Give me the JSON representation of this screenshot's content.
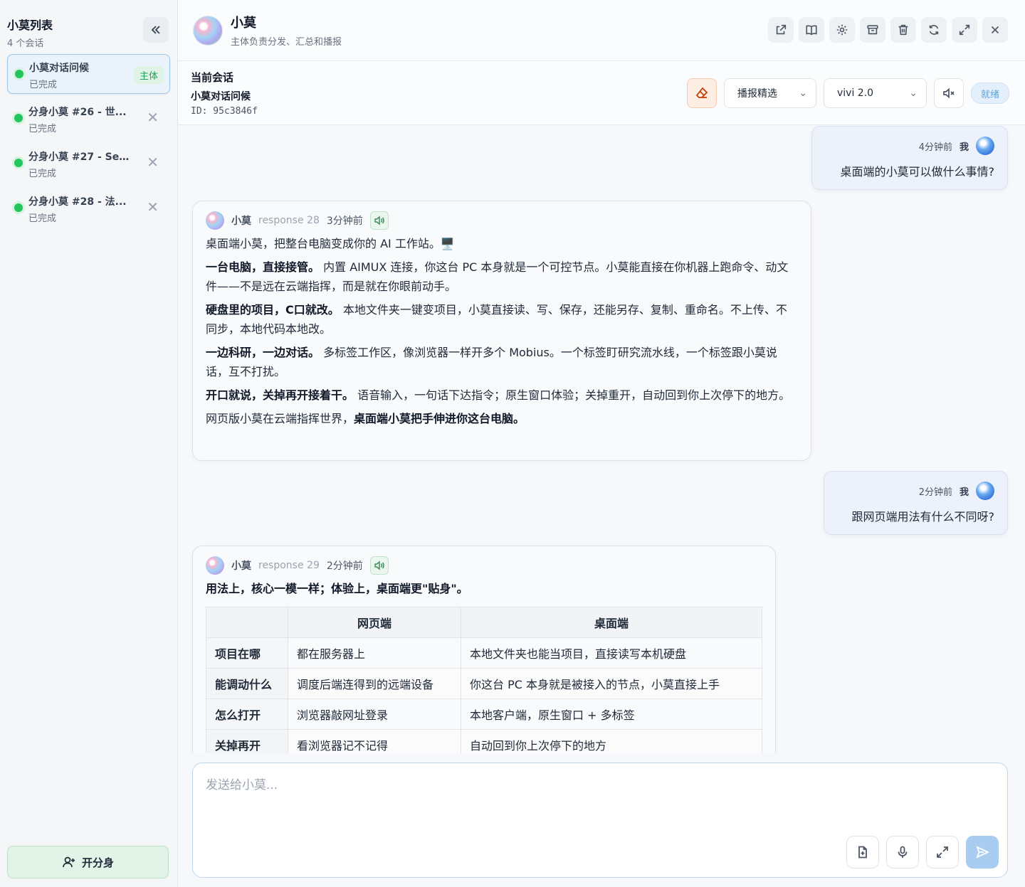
{
  "sidebar": {
    "title": "小莫列表",
    "count": "4 个会话",
    "items": [
      {
        "name": "小莫对话问候",
        "status": "已完成",
        "tag": "主体"
      },
      {
        "name": "分身小莫 #26 - 世...",
        "status": "已完成"
      },
      {
        "name": "分身小莫 #27 - Sel...",
        "status": "已完成"
      },
      {
        "name": "分身小莫 #28 - 法...",
        "status": "已完成"
      }
    ],
    "new_button": "开分身"
  },
  "topbar": {
    "name": "小莫",
    "subtitle": "主体负责分发、汇总和播报"
  },
  "session": {
    "label": "当前会话",
    "name": "小莫对话问候",
    "id": "ID: 95c3846f",
    "broadcast_select": "播报精选",
    "model_select": "vivi 2.0",
    "status": "就绪"
  },
  "messages": {
    "u1": {
      "time": "4分钟前",
      "who": "我",
      "text": "桌面端的小莫可以做什么事情?"
    },
    "b1": {
      "name": "小莫",
      "resp": "response 28",
      "time": "3分钟前",
      "p1": "桌面端小莫，把整台电脑变成你的 AI 工作站。🖥️",
      "p2_b": "一台电脑，直接接管。",
      "p2": " 内置 AIMUX 连接，你这台 PC 本身就是一个可控节点。小莫能直接在你机器上跑命令、动文件——不是远在云端指挥，而是就在你眼前动手。",
      "p3_b": "硬盘里的项目，C口就改。",
      "p3": " 本地文件夹一键变项目，小莫直接读、写、保存，还能另存、复制、重命名。不上传、不同步，本地代码本地改。",
      "p4_b": "一边科研，一边对话。",
      "p4": " 多标签工作区，像浏览器一样开多个 Mobius。一个标签盯研究流水线，一个标签跟小莫说话，互不打扰。",
      "p5_b": "开口就说，关掉再开接着干。",
      "p5": " 语音输入，一句话下达指令；原生窗口体验；关掉重开，自动回到你上次停下的地方。",
      "p6": "网页版小莫在云端指挥世界，",
      "p6_b": "桌面端小莫把手伸进你这台电脑。"
    },
    "u2": {
      "time": "2分钟前",
      "who": "我",
      "text": "跟网页端用法有什么不同呀?"
    },
    "b2": {
      "name": "小莫",
      "resp": "response 29",
      "time": "2分钟前",
      "lead": "用法上，核心一模一样；体验上，桌面端更\"贴身\"。",
      "table": {
        "headers": [
          "",
          "网页端",
          "桌面端"
        ],
        "rows": [
          [
            "项目在哪",
            "都在服务器上",
            "本地文件夹也能当项目，直接读写本机硬盘"
          ],
          [
            "能调动什么",
            "调度后端连得到的远端设备",
            "你这台 PC 本身就是被接入的节点，小莫直接上手"
          ],
          [
            "怎么打开",
            "浏览器敲网址登录",
            "本地客户端，原生窗口 + 多标签"
          ],
          [
            "关掉再开",
            "看浏览器记不记得",
            "自动回到你上次停下的地方"
          ]
        ]
      }
    }
  },
  "composer": {
    "placeholder": "发送给小莫..."
  }
}
